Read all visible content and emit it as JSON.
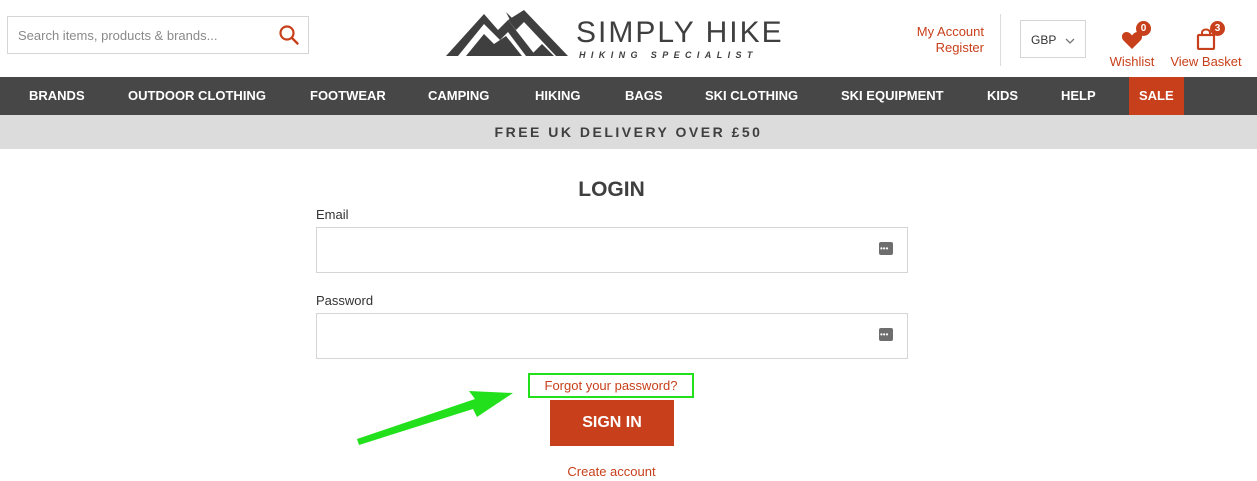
{
  "header": {
    "search_placeholder": "Search items, products & brands...",
    "logo_title": "SIMPLY HIKE",
    "logo_subtitle": "HIKING SPECIALIST",
    "my_account": "My Account",
    "register": "Register",
    "currency": "GBP",
    "wishlist_label": "Wishlist",
    "wishlist_count": "0",
    "basket_label": "View Basket",
    "basket_count": "3"
  },
  "nav": {
    "items": [
      "BRANDS",
      "OUTDOOR CLOTHING",
      "FOOTWEAR",
      "CAMPING",
      "HIKING",
      "BAGS",
      "SKI CLOTHING",
      "SKI EQUIPMENT",
      "KIDS",
      "HELP",
      "SALE"
    ]
  },
  "promo": {
    "text": "FREE UK DELIVERY OVER £50"
  },
  "login": {
    "title": "LOGIN",
    "email_label": "Email",
    "email_value": "",
    "password_label": "Password",
    "password_value": "",
    "forgot_link": "Forgot your password?",
    "signin_button": "SIGN IN",
    "create_account": "Create account"
  },
  "colors": {
    "accent": "#c8401b",
    "nav_bg": "#474747",
    "promo_bg": "#dcdcdc",
    "highlight": "#22e01c"
  }
}
